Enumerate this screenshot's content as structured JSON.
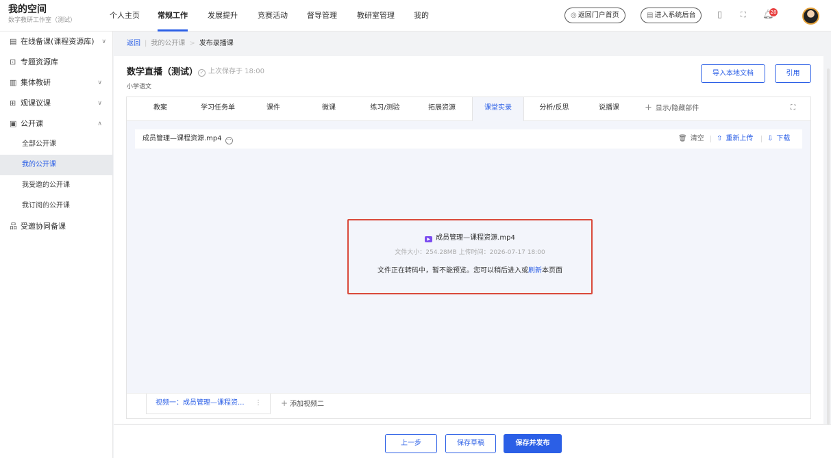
{
  "header": {
    "brand_title": "我的空间",
    "brand_subtitle": "数字教研工作室（测试）",
    "nav": [
      "个人主页",
      "常规工作",
      "发展提升",
      "竞赛活动",
      "督导管理",
      "教研室管理",
      "我的"
    ],
    "active_nav": "常规工作",
    "portal_button": "返回门户首页",
    "admin_button": "进入系统后台",
    "notification_count": "28"
  },
  "sidebar": {
    "items": [
      {
        "icon": "▤",
        "label": "在线备课(课程资源库)",
        "chevron": "∨"
      },
      {
        "icon": "⊡",
        "label": "专题资源库",
        "chevron": ""
      },
      {
        "icon": "▥",
        "label": "集体教研",
        "chevron": "∨"
      },
      {
        "icon": "⊞",
        "label": "观课议课",
        "chevron": "∨"
      },
      {
        "icon": "▣",
        "label": "公开课",
        "chevron": "∧"
      }
    ],
    "subitems": [
      "全部公开课",
      "我的公开课",
      "我受邀的公开课",
      "我订阅的公开课"
    ],
    "active_subitem": "我的公开课",
    "last_item": {
      "icon": "品",
      "label": "受邀协同备课"
    }
  },
  "breadcrumb": {
    "back": "返回",
    "parent": "我的公开课",
    "current": "发布录播课",
    "separator": ">"
  },
  "doc": {
    "title": "数学直播（测试）",
    "save_status": "上次保存于 18:00",
    "subject": "小学语文",
    "import_button": "导入本地文档",
    "cite_button": "引用"
  },
  "tabs": {
    "items": [
      "教案",
      "学习任务单",
      "课件",
      "微课",
      "练习/测验",
      "拓展资源",
      "课堂实录",
      "分析/反思",
      "说播课"
    ],
    "active": "课堂实录",
    "toggle_parts": "显示/隐藏部件"
  },
  "file": {
    "name": "成员管理—课程资源.mp4",
    "clear": "清空",
    "reupload": "重新上传",
    "download": "下载"
  },
  "preview": {
    "filename": "成员管理—课程资源.mp4",
    "meta": "文件大小：254.28MB 上传时间：2026-07-17 18:00",
    "msg_before": "文件正在转码中，暂不能预览。您可以稍后进入或",
    "msg_link": "刷新",
    "msg_after": "本页面"
  },
  "videos": {
    "tab1": "视频一：成员管理—课程资...",
    "add": "添加视频二"
  },
  "footer": {
    "prev": "上一步",
    "save_draft": "保存草稿",
    "publish": "保存并发布"
  },
  "colors": {
    "accent": "#2b5fe6",
    "highlight_border": "#d9493a",
    "badge": "#e84040",
    "video_icon": "#7b4cf0"
  }
}
